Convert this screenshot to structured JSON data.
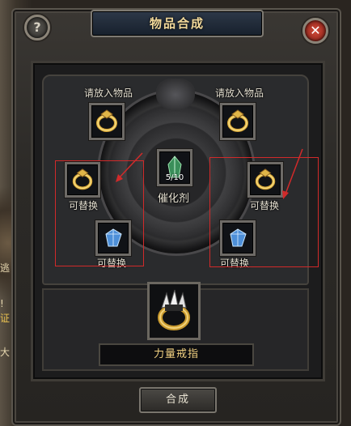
{
  "window": {
    "title": "物品合成",
    "help_symbol": "?",
    "close_symbol": "✕"
  },
  "left_input": {
    "label": "请放入物品",
    "icon": "gold-ring-icon"
  },
  "right_input": {
    "label": "请放入物品",
    "icon": "gold-ring-icon"
  },
  "catalyst": {
    "label": "催化剂",
    "count": "5/10",
    "icon": "green-crystal-icon"
  },
  "left_replaceables": [
    {
      "label": "可替换",
      "icon": "gold-ring-icon"
    },
    {
      "label": "可替换",
      "icon": "blue-gem-icon"
    }
  ],
  "right_replaceables": [
    {
      "label": "可替换",
      "icon": "gold-ring-icon"
    },
    {
      "label": "可替换",
      "icon": "blue-gem-icon"
    }
  ],
  "result": {
    "name": "力量戒指",
    "icon": "power-ring-icon"
  },
  "compose_button": "合成",
  "left_edge_text": [
    "逃",
    "!",
    "证",
    "大"
  ],
  "colors": {
    "title": "#f2d99a",
    "highlight": "#d12a2a",
    "result_name": "#f0d080"
  }
}
